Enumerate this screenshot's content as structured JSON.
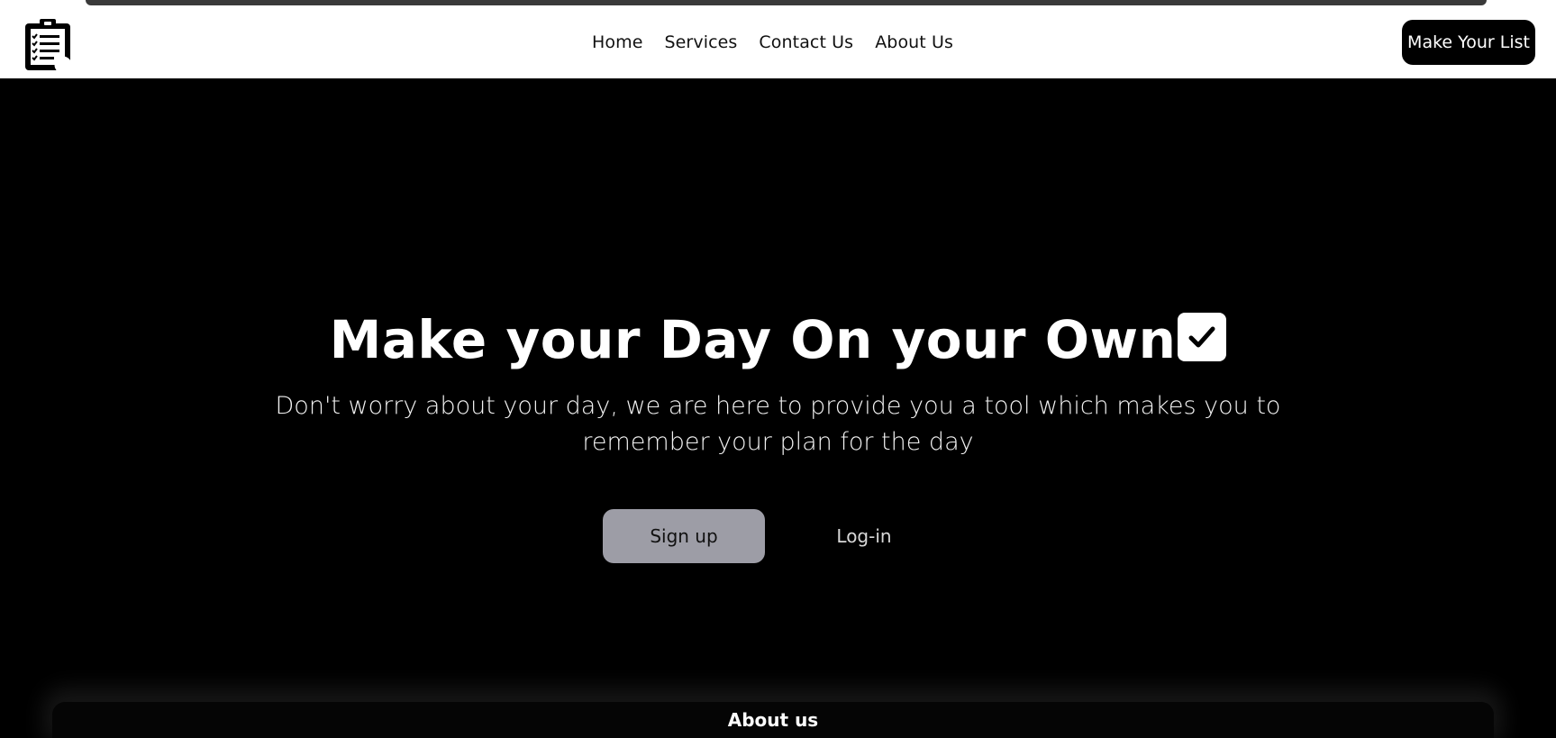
{
  "nav": {
    "logo_icon": "clipboard-checklist-icon",
    "links": [
      "Home",
      "Services",
      "Contact Us",
      "About Us"
    ],
    "cta_label": "Make Your List"
  },
  "hero": {
    "title": "Make your Day On your Own",
    "title_icon": "check-box-icon",
    "subtitle": "Don't worry about your day, we are here to provide you a tool which makes you to remember your plan for the day",
    "signup_label": "Sign up",
    "login_label": "Log-in"
  },
  "about": {
    "title": "About us"
  },
  "colors": {
    "background": "#000000",
    "navbar": "#ffffff",
    "signup_button": "#9d9da6"
  }
}
